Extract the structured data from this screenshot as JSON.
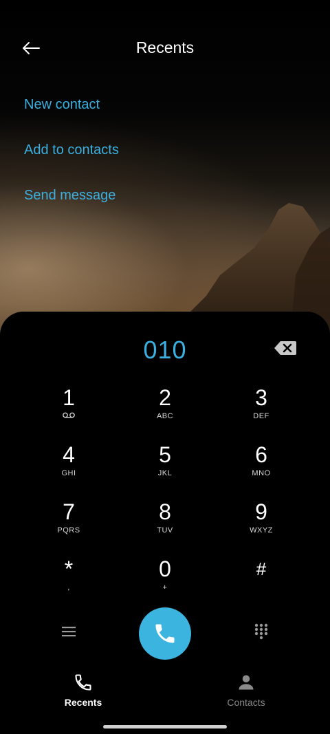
{
  "header": {
    "title": "Recents",
    "back_icon": "arrow-left-icon"
  },
  "actions": [
    {
      "label": "New contact"
    },
    {
      "label": "Add to contacts"
    },
    {
      "label": "Send message"
    }
  ],
  "dialer": {
    "number": "010",
    "keys": [
      {
        "digit": "1",
        "letters": ""
      },
      {
        "digit": "2",
        "letters": "ABC"
      },
      {
        "digit": "3",
        "letters": "DEF"
      },
      {
        "digit": "4",
        "letters": "GHI"
      },
      {
        "digit": "5",
        "letters": "JKL"
      },
      {
        "digit": "6",
        "letters": "MNO"
      },
      {
        "digit": "7",
        "letters": "PQRS"
      },
      {
        "digit": "8",
        "letters": "TUV"
      },
      {
        "digit": "9",
        "letters": "WXYZ"
      },
      {
        "digit": "*",
        "letters": ","
      },
      {
        "digit": "0",
        "letters": "+"
      },
      {
        "digit": "#",
        "letters": ""
      }
    ]
  },
  "nav": {
    "recents_label": "Recents",
    "contacts_label": "Contacts"
  },
  "colors": {
    "accent": "#3bb0e0",
    "call_button": "#3bb5df",
    "background": "#000000"
  }
}
